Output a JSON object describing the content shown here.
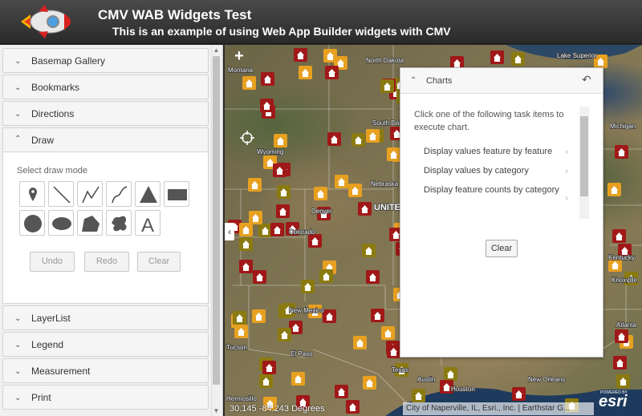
{
  "header": {
    "title": "CMV WAB Widgets Test",
    "subtitle": "This is an example of using Web App Builder widgets with CMV"
  },
  "sidebar": {
    "panes_top": [
      {
        "label": "Basemap Gallery",
        "state": "collapsed"
      },
      {
        "label": "Bookmarks",
        "state": "collapsed"
      },
      {
        "label": "Directions",
        "state": "collapsed"
      },
      {
        "label": "Draw",
        "state": "expanded"
      }
    ],
    "panes_bottom": [
      {
        "label": "LayerList",
        "state": "collapsed"
      },
      {
        "label": "Legend",
        "state": "collapsed"
      },
      {
        "label": "Measurement",
        "state": "collapsed"
      },
      {
        "label": "Print",
        "state": "collapsed"
      }
    ],
    "draw": {
      "mode_label": "Select draw mode",
      "tools": [
        "point",
        "line",
        "polyline",
        "freehand-polyline",
        "triangle",
        "rectangle",
        "circle",
        "ellipse",
        "polygon",
        "freehand-polygon",
        "text"
      ],
      "undo_label": "Undo",
      "redo_label": "Redo",
      "clear_label": "Clear"
    }
  },
  "map": {
    "zoom_in": "+",
    "coordinates": "30.145 -84.243 Degrees",
    "attribution": "City of Naperville, IL, Esri., Inc. | Earthstar G...",
    "logo_text": "esri",
    "logo_powered": "POWERED BY",
    "labels": [
      {
        "text": "Montana"
      },
      {
        "text": "North Dakota"
      },
      {
        "text": "South Dakota"
      },
      {
        "text": "Wyoming"
      },
      {
        "text": "Nebraska"
      },
      {
        "text": "Denver"
      },
      {
        "text": "Colorado"
      },
      {
        "text": "UNITED STATES"
      },
      {
        "text": "New Mexico"
      },
      {
        "text": "El Paso"
      },
      {
        "text": "Tucson"
      },
      {
        "text": "Texas"
      },
      {
        "text": "Austin"
      },
      {
        "text": "Houston"
      },
      {
        "text": "New Orleans"
      },
      {
        "text": "Hermosillo"
      },
      {
        "text": "Lake Superior"
      },
      {
        "text": "Michigan"
      },
      {
        "text": "Knoxville"
      },
      {
        "text": "Atlanta"
      },
      {
        "text": "Kentucky"
      }
    ]
  },
  "charts": {
    "title": "Charts",
    "description": "Click one of the following task items to execute chart.",
    "tasks": [
      "Display values feature by feature",
      "Display values by category",
      "Display feature counts by category"
    ],
    "clear_label": "Clear"
  },
  "colors": {
    "header_bg": "#333333",
    "marker_orange": "#e8a020",
    "marker_red": "#a01818",
    "marker_olive": "#8a7a10"
  }
}
